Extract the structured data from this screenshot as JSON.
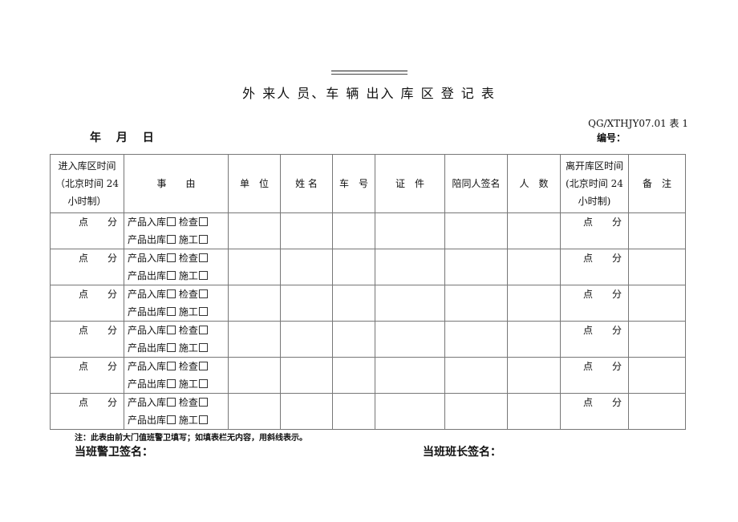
{
  "title": "外 来人 员、车 辆 出入 库 区 登 记 表",
  "doc_code": "QG/XTHJY07.01 表 1",
  "date_label": "年 月 日",
  "serial_label": "编号：",
  "table": {
    "headers": [
      "进入库区时间（北京时间 24 小时制）",
      "事　　由",
      "单　位",
      "姓 名",
      "车　号",
      "证　件",
      "陪同人签名",
      "人　数",
      "离开库区时间(北京时间 24 小时制)",
      "备　注"
    ],
    "time_placeholder": "点　　分",
    "reason_line1": "产品入库",
    "reason_opt1": "检查",
    "reason_line2": "产品出库",
    "reason_opt2": "施工",
    "row_count": 6
  },
  "note": "注：此表由前大门值班警卫填写；如填表栏无内容，用斜线表示。",
  "guard_signature_label": "当班警卫签名：",
  "leader_signature_label": "当班班长签名："
}
